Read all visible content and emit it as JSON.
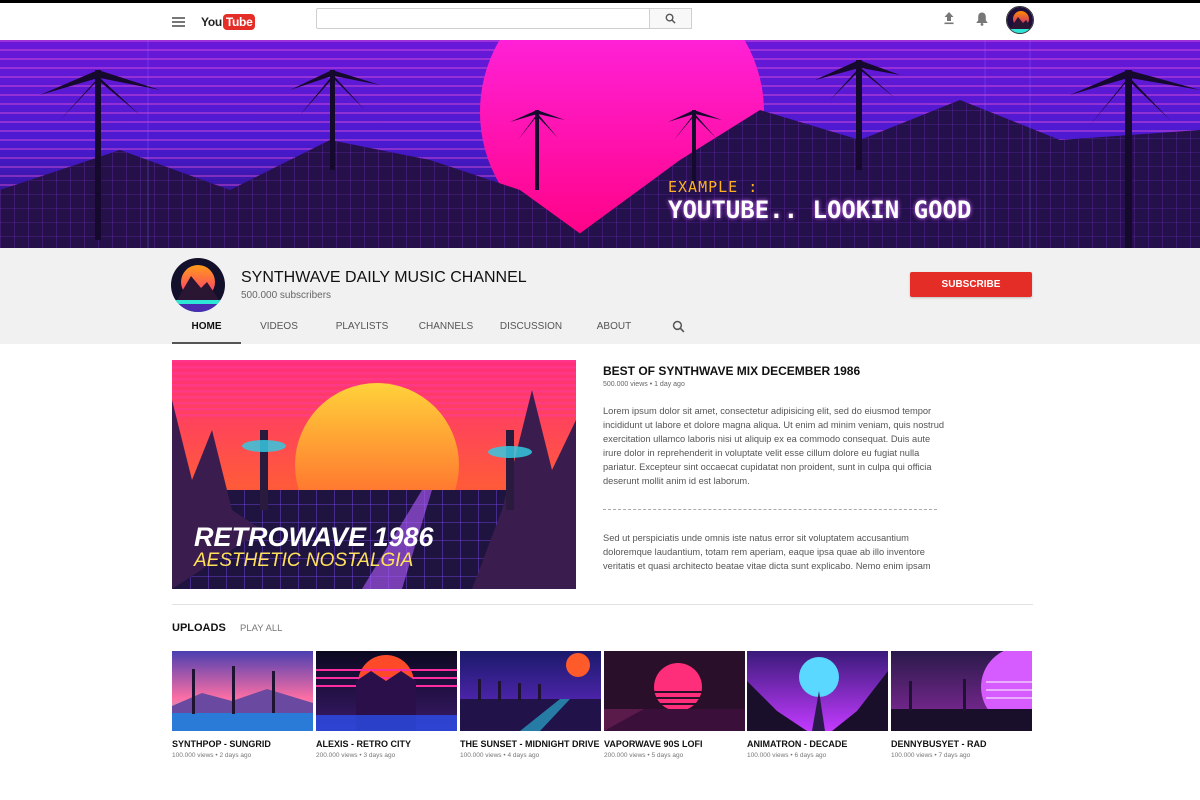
{
  "masthead": {
    "logo_you": "You",
    "logo_tube": "Tube",
    "search_value": "",
    "icons": [
      "menu-icon",
      "search-icon",
      "upload-icon",
      "bell-icon"
    ]
  },
  "banner": {
    "line1": "EXAMPLE :",
    "line2": "YOUTUBE.. LOOKIN GOOD"
  },
  "channel": {
    "name": "SYNTHWAVE DAILY MUSIC CHANNEL",
    "subscribers": "500.000 subscribers",
    "subscribe_label": "SUBSCRIBE",
    "tabs": [
      {
        "label": "HOME",
        "active": true
      },
      {
        "label": "VIDEOS",
        "active": false
      },
      {
        "label": "PLAYLISTS",
        "active": false
      },
      {
        "label": "CHANNELS",
        "active": false
      },
      {
        "label": "DISCUSSION",
        "active": false
      },
      {
        "label": "ABOUT",
        "active": false
      }
    ]
  },
  "featured": {
    "thumb_line1": "RETROWAVE 1986",
    "thumb_line2": "AESTHETIC NOSTALGIA",
    "title": "BEST OF SYNTHWAVE MIX DECEMBER 1986",
    "meta": "500.000 views • 1 day ago",
    "description": "Lorem ipsum dolor sit amet, consectetur adipisicing elit, sed do eiusmod tempor incididunt ut labore et dolore magna aliqua. Ut enim ad minim veniam, quis nostrud exercitation ullamco laboris nisi ut aliquip ex ea commodo consequat. Duis aute irure dolor in reprehenderit in voluptate velit esse cillum dolore eu fugiat nulla pariatur. Excepteur sint occaecat cupidatat non proident, sunt in culpa qui officia deserunt mollit anim id est laborum.",
    "description2": "Sed ut perspiciatis unde omnis iste natus error sit voluptatem accusantium doloremque laudantium, totam rem aperiam, eaque ipsa quae ab illo inventore veritatis et quasi architecto beatae vitae dicta sunt explicabo. Nemo enim ipsam"
  },
  "uploads": {
    "title": "UPLOADS",
    "play_all": "PLAY ALL",
    "videos": [
      {
        "title": "SYNTHPOP - SUNGRID",
        "meta": "100.000 views • 2 days ago"
      },
      {
        "title": "ALEXIS - RETRO CITY",
        "meta": "200.000 views • 3 days ago"
      },
      {
        "title": "THE SUNSET - MIDNIGHT DRIVE",
        "meta": "100.000 views • 4 days ago"
      },
      {
        "title": "VAPORWAVE 90S LOFI",
        "meta": "200.000 views • 5 days ago"
      },
      {
        "title": "ANIMATRON - DECADE",
        "meta": "100.000 views • 6 days ago"
      },
      {
        "title": "DENNYBUSYET - RAD",
        "meta": "100.000 views • 7 days ago"
      }
    ]
  },
  "colors": {
    "brand_red": "#e52d27",
    "banner_accent": "#ffb21e"
  }
}
